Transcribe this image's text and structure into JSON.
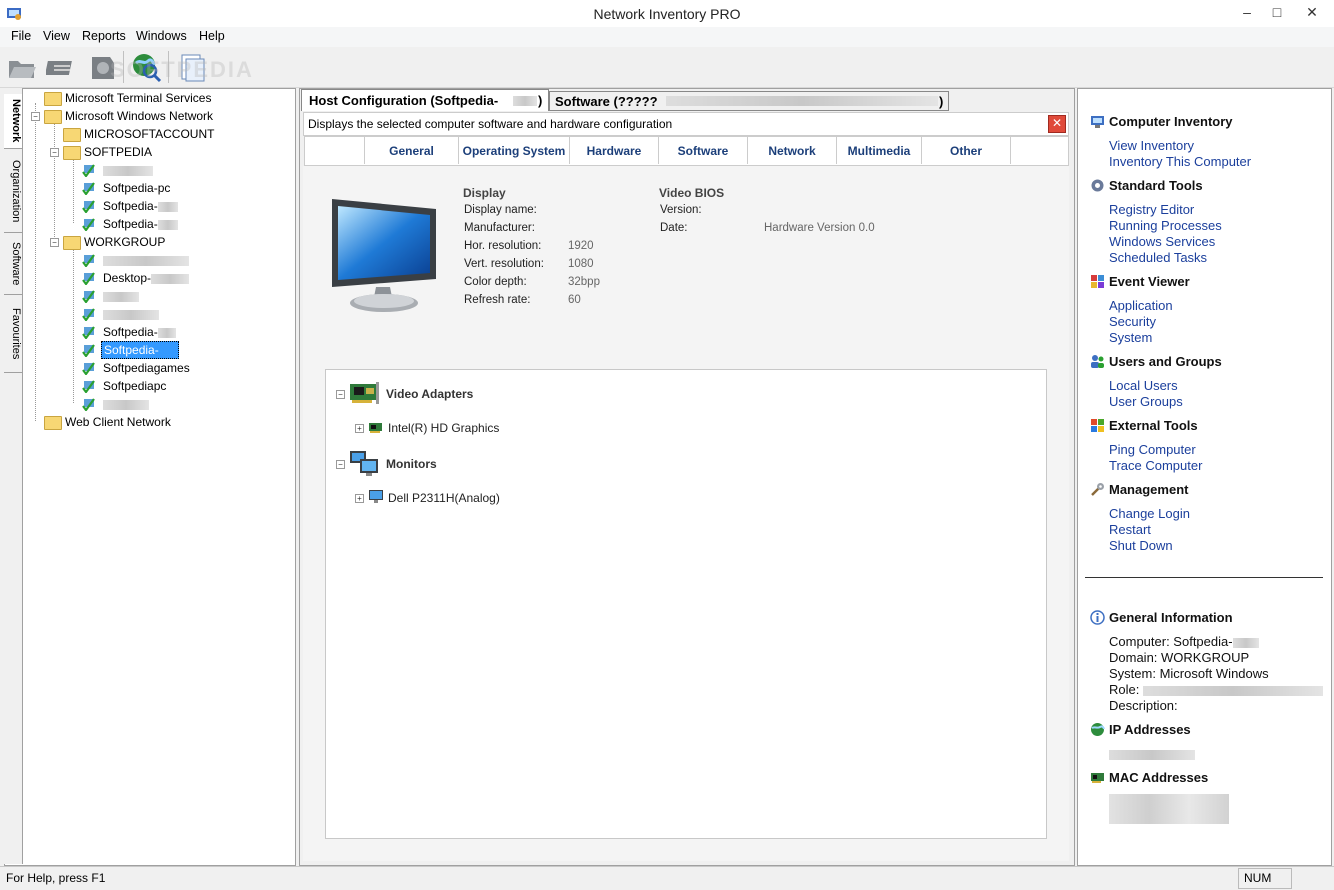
{
  "window": {
    "title": "Network Inventory PRO"
  },
  "menu": [
    "File",
    "View",
    "Reports",
    "Windows",
    "Help"
  ],
  "watermark": "SOFTPEDIA",
  "sidetabs": [
    "Network",
    "Organization",
    "Software",
    "Favourites"
  ],
  "tree": {
    "root1": "Microsoft Terminal Services",
    "root2": "Microsoft Windows Network",
    "g1": "MICROSOFTACCOUNT",
    "g2": "SOFTPEDIA",
    "s1": "Softpedia-pc",
    "s2": "Softpedia-",
    "s3": "Softpedia-",
    "g3": "WORKGROUP",
    "w1": "Desktop-",
    "w2": "Softpedia-",
    "w3": "Softpedia-",
    "w4": "Softpediagames",
    "w5": "Softpediapc",
    "root3": "Web Client Network"
  },
  "tabs": {
    "host": "Host Configuration (Softpedia-",
    "host_end": ")",
    "software": "Software (?????",
    "software_end": ")"
  },
  "info_text": "Displays the selected computer software and hardware configuration",
  "subtabs": [
    "General",
    "Operating System",
    "Hardware",
    "Software",
    "Network",
    "Multimedia",
    "Other"
  ],
  "display": {
    "header": "Display",
    "rows": [
      {
        "label": "Display name:",
        "value": ""
      },
      {
        "label": "Manufacturer:",
        "value": ""
      },
      {
        "label": "Hor. resolution:",
        "value": "1920"
      },
      {
        "label": "Vert. resolution:",
        "value": "1080"
      },
      {
        "label": "Color depth:",
        "value": "32bpp"
      },
      {
        "label": "Refresh rate:",
        "value": "60"
      }
    ]
  },
  "bios": {
    "header": "Video BIOS",
    "rows": [
      {
        "label": "Version:",
        "value": ""
      },
      {
        "label": "Date:",
        "value": "Hardware Version 0.0"
      }
    ]
  },
  "devices": {
    "video_header": "Video Adapters",
    "video_item": "Intel(R) HD Graphics",
    "monitors_header": "Monitors",
    "monitor_item": "Dell P2311H(Analog)"
  },
  "right": {
    "computer_inventory": "Computer Inventory",
    "view_inventory": "View Inventory",
    "inventory_this": "Inventory This Computer",
    "standard_tools": "Standard Tools",
    "registry_editor": "Registry Editor",
    "running_processes": "Running Processes",
    "windows_services": "Windows Services",
    "scheduled_tasks": "Scheduled Tasks",
    "event_viewer": "Event Viewer",
    "application": "Application",
    "security": "Security",
    "system": "System",
    "users_groups": "Users and Groups",
    "local_users": "Local Users",
    "user_groups": "User Groups",
    "external_tools": "External Tools",
    "ping": "Ping Computer",
    "trace": "Trace Computer",
    "management": "Management",
    "change_login": "Change Login",
    "restart": "Restart",
    "shutdown": "Shut Down",
    "general_info": "General Information",
    "computer": "Computer: Softpedia-",
    "domain": "Domain: WORKGROUP",
    "system_info": "System: Microsoft Windows",
    "role": "Role:",
    "description": "Description:",
    "ip_addresses": "IP Addresses",
    "mac_addresses": "MAC Addresses"
  },
  "status": {
    "help": "For Help, press F1",
    "num": "NUM"
  }
}
